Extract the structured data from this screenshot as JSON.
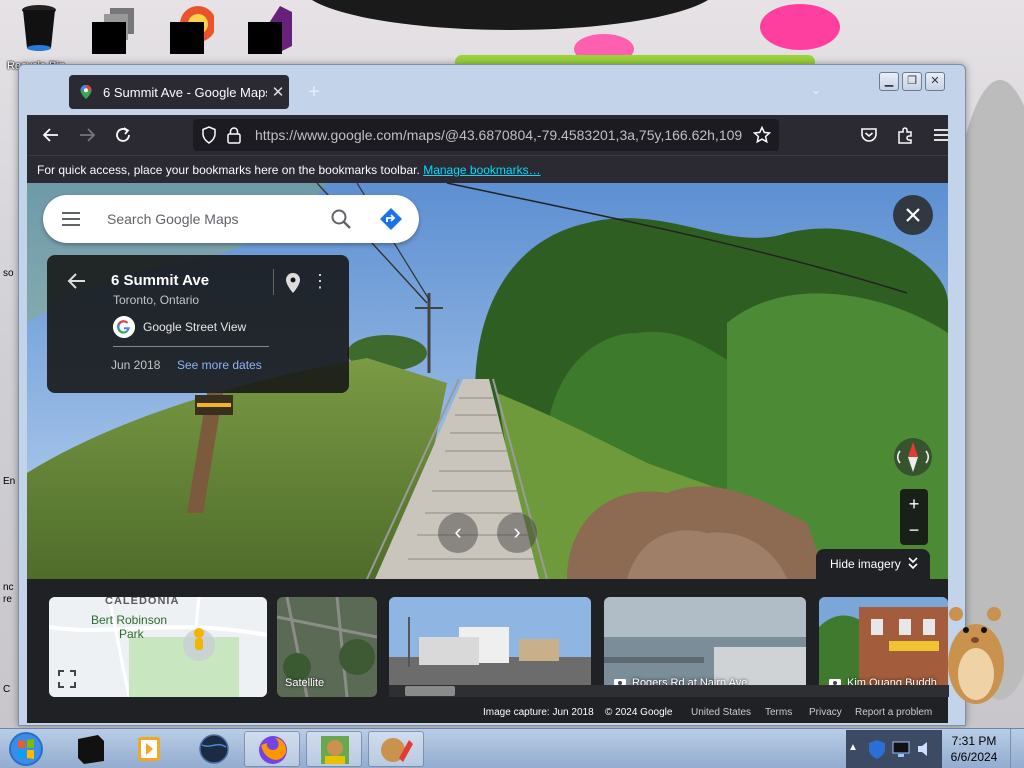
{
  "desktop": {
    "icons": [
      {
        "label": "Recycle Bin",
        "icon": "recycle-bin-icon"
      },
      {
        "label": "",
        "icon": "redacted-app-icon"
      },
      {
        "label": "",
        "icon": "browser-app-icon"
      },
      {
        "label": "Visual Studio",
        "icon": "visual-studio-icon"
      }
    ],
    "side_labels": [
      "so",
      "En",
      "nc re",
      "C"
    ]
  },
  "browser": {
    "tab_title": "6 Summit Ave - Google Maps",
    "tab_close": "✕",
    "new_tab": "+",
    "url": "https://www.google.com/maps/@43.6870804,-79.4583201,3a,75y,166.62h,109",
    "bookmarks_hint": "For quick access, place your bookmarks here on the bookmarks toolbar.",
    "bookmarks_link": "Manage bookmarks…",
    "controls": {
      "minimize": "▁",
      "maximize": "❐",
      "close": "✕"
    }
  },
  "maps": {
    "search_placeholder": "Search Google Maps",
    "place": {
      "title": "6 Summit Ave",
      "subtitle": "Toronto, Ontario",
      "source": "Google Street View",
      "date": "Jun 2018",
      "more_dates": "See more dates"
    },
    "hide_imagery": "Hide imagery",
    "zoom_in": "+",
    "zoom_out": "−",
    "thumbnails": [
      {
        "kind": "map",
        "labels": [
          "CALEDONIA",
          "Bert Robinson",
          "Park"
        ]
      },
      {
        "kind": "satellite",
        "caption": "Satellite"
      },
      {
        "kind": "streetview",
        "caption": ""
      },
      {
        "kind": "photo",
        "caption": "Rogers Rd at Nairn Ave"
      },
      {
        "kind": "photo",
        "caption": "Kim Quang Buddh"
      }
    ],
    "footer": {
      "capture": "Image capture: Jun 2018",
      "copyright": "© 2024 Google",
      "region": "United States",
      "terms": "Terms",
      "privacy": "Privacy",
      "report": "Report a problem"
    }
  },
  "taskbar": {
    "apps": [
      "start",
      "app-black",
      "media-player",
      "browser-dark",
      "firefox",
      "box-game",
      "paint-app"
    ],
    "time": "7:31 PM",
    "date": "6/6/2024"
  },
  "colors": {
    "chrome_dark": "#2b2a33",
    "maps_link": "#8ab4f8",
    "bookmark_link": "#00ddff",
    "card_bg": "#141414"
  }
}
